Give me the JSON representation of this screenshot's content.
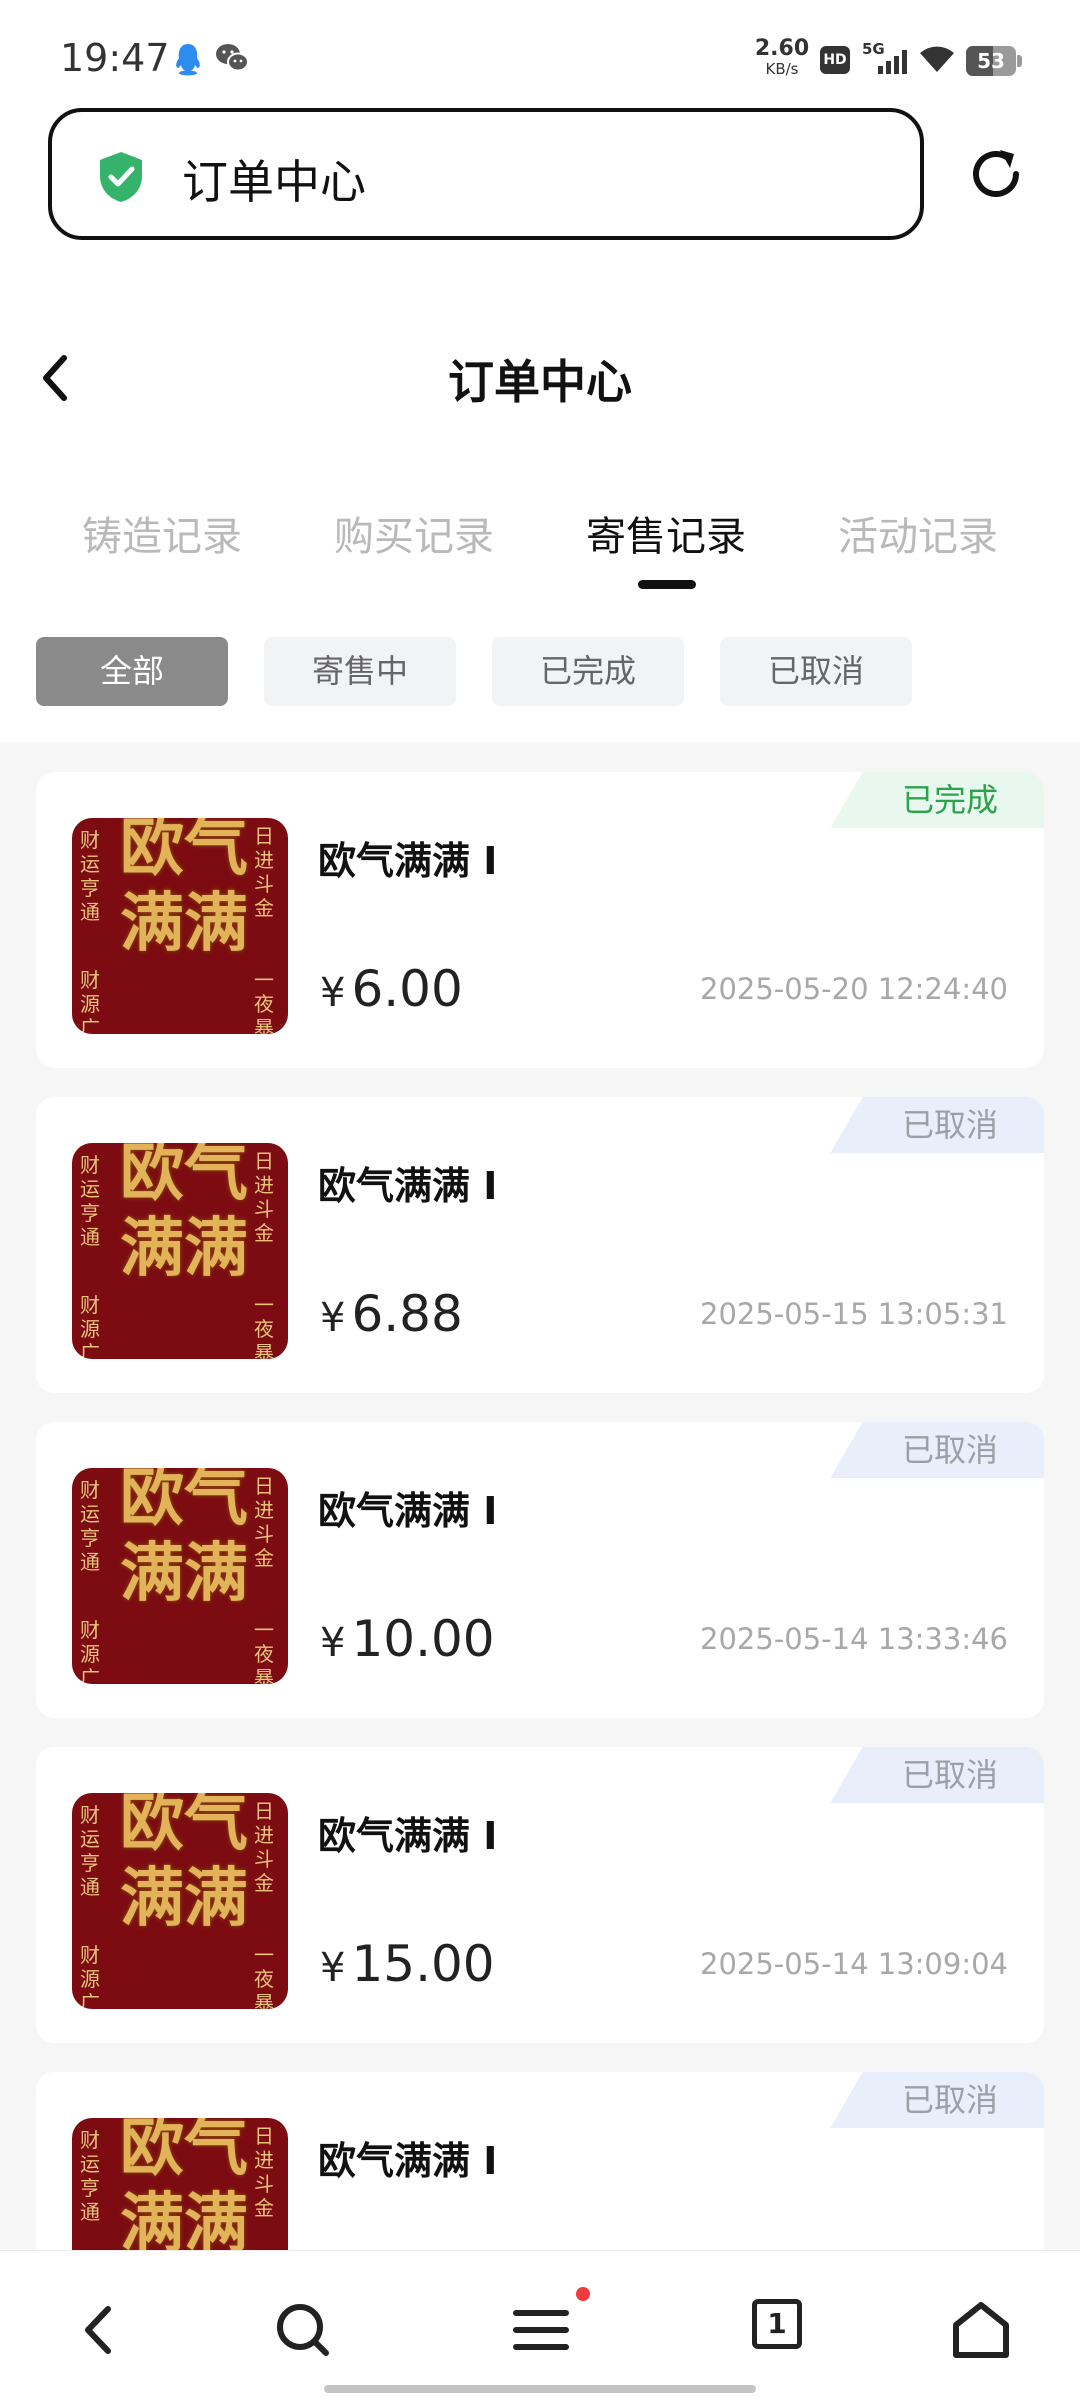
{
  "status_bar": {
    "time": "19:47",
    "net_speed_value": "2.60",
    "net_speed_unit": "KB/s",
    "hd_label": "HD",
    "network_type": "5G",
    "battery_level": "53",
    "icons": [
      "qq-icon",
      "wechat-icon",
      "hd-icon",
      "signal-5g-icon",
      "wifi-icon",
      "battery-icon"
    ]
  },
  "browser": {
    "url_text": "订单中心",
    "icons": [
      "shield-check-icon",
      "refresh-icon"
    ]
  },
  "header": {
    "title": "订单中心",
    "back_icon": "chevron-left-icon"
  },
  "tabs": [
    {
      "label": "铸造记录",
      "active": false
    },
    {
      "label": "购买记录",
      "active": false
    },
    {
      "label": "寄售记录",
      "active": true
    },
    {
      "label": "活动记录",
      "active": false
    }
  ],
  "filters": [
    {
      "label": "全部",
      "active": true
    },
    {
      "label": "寄售中",
      "active": false
    },
    {
      "label": "已完成",
      "active": false
    },
    {
      "label": "已取消",
      "active": false
    }
  ],
  "orders": [
    {
      "name": "欧气满满 I",
      "currency": "¥",
      "price": "6.00",
      "date": "2025-05-20 12:24:40",
      "status": "已完成",
      "status_color": "#2aa34a"
    },
    {
      "name": "欧气满满 I",
      "currency": "¥",
      "price": "6.88",
      "date": "2025-05-15 13:05:31",
      "status": "已取消",
      "status_color": "#9aa0a6"
    },
    {
      "name": "欧气满满 I",
      "currency": "¥",
      "price": "10.00",
      "date": "2025-05-14 13:33:46",
      "status": "已取消",
      "status_color": "#9aa0a6"
    },
    {
      "name": "欧气满满 I",
      "currency": "¥",
      "price": "15.00",
      "date": "2025-05-14 13:09:04",
      "status": "已取消",
      "status_color": "#9aa0a6"
    },
    {
      "name": "欧气满满 I",
      "status": "已取消",
      "status_color": "#9aa0a6"
    }
  ],
  "thumbnail": {
    "main_text": "欧气满满",
    "left_text": "财运亨通",
    "right_text": "日进斗金",
    "left_text_2": "财源广",
    "right_text_2": "一夜暴"
  },
  "bottom_nav": {
    "items": [
      "back-icon",
      "search-icon",
      "menu-icon",
      "tabs-icon",
      "home-icon"
    ],
    "tab_count": "1"
  },
  "colors": {
    "accent_green": "#2aa34a",
    "active_chip": "#8a8a8a",
    "notification_dot": "#ef3b3b",
    "shield_green": "#35b36a"
  }
}
